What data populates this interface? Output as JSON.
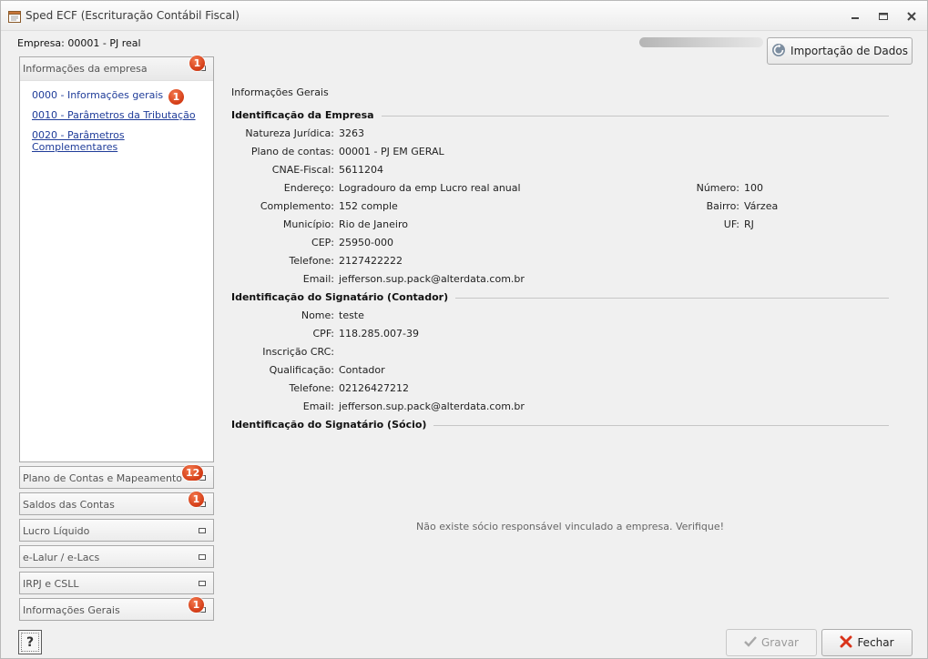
{
  "window": {
    "title": "Sped ECF (Escrituração Contábil Fiscal)"
  },
  "company": {
    "label": "Empresa: 00001 - PJ real"
  },
  "toolbar": {
    "import_label": "Importação de Dados",
    "save_label": "Gravar",
    "close_label": "Fechar",
    "help_label": "?"
  },
  "sidebar": {
    "open_panel": {
      "title": "Informações da empresa",
      "badge": "1",
      "links": [
        {
          "label": "0000 - Informações gerais",
          "badge": "1"
        },
        {
          "label": "0010 - Parâmetros da Tributação"
        },
        {
          "label": "0020 - Parâmetros Complementares"
        }
      ]
    },
    "panels": [
      {
        "label": "Plano de Contas e Mapeamento",
        "badge": "12"
      },
      {
        "label": "Saldos das Contas",
        "badge": "1"
      },
      {
        "label": "Lucro Líquido"
      },
      {
        "label": "e-Lalur / e-Lacs"
      },
      {
        "label": "IRPJ e CSLL"
      },
      {
        "label": "Informações Gerais",
        "badge": "1"
      }
    ]
  },
  "main": {
    "caption": "Informações Gerais",
    "empresa": {
      "heading": "Identificação da Empresa",
      "natureza_label": "Natureza Jurídica:",
      "natureza": "3263",
      "plano_label": "Plano de contas:",
      "plano": "00001 - PJ EM GERAL",
      "cnae_label": "CNAE-Fiscal:",
      "cnae": "5611204",
      "endereco_label": "Endereço:",
      "endereco": "Logradouro da emp Lucro real anual",
      "numero_label": "Número:",
      "numero": "100",
      "complemento_label": "Complemento:",
      "complemento": "152 comple",
      "bairro_label": "Bairro:",
      "bairro": "Várzea",
      "municipio_label": "Município:",
      "municipio": "Rio de Janeiro",
      "uf_label": "UF:",
      "uf": "RJ",
      "cep_label": "CEP:",
      "cep": "25950-000",
      "telefone_label": "Telefone:",
      "telefone": "2127422222",
      "email_label": "Email:",
      "email": "jefferson.sup.pack@alterdata.com.br"
    },
    "contador": {
      "heading": "Identificação do Signatário (Contador)",
      "nome_label": "Nome:",
      "nome": "teste",
      "cpf_label": "CPF:",
      "cpf": "118.285.007-39",
      "crc_label": "Inscrição CRC:",
      "crc": "",
      "qualificacao_label": "Qualificação:",
      "qualificacao": "Contador",
      "telefone_label": "Telefone:",
      "telefone": "02126427212",
      "email_label": "Email:",
      "email": "jefferson.sup.pack@alterdata.com.br"
    },
    "socio": {
      "heading": "Identificação do Signatário (Sócio)",
      "empty_message": "Não existe sócio responsável vinculado a empresa. Verifique!"
    }
  },
  "colors": {
    "link": "#1f3c99",
    "badge": "#d33c16",
    "close_icon": "#d9331a",
    "save_icon": "#a0a0a0"
  },
  "icons": [
    "app-icon",
    "minimize-icon",
    "restore-icon",
    "close-icon",
    "import-icon",
    "check-icon",
    "close-x-icon",
    "help-icon"
  ]
}
